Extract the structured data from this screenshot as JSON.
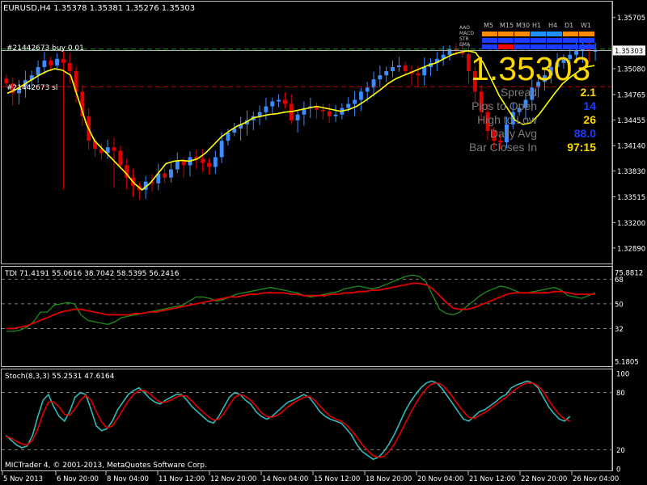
{
  "header": {
    "symbol_line": "EURUSD,H4  1.35378 1.35381 1.35276 1.35303",
    "tdi_line": "TDI 71.4191 55.0616 38.7042 58.5395 56.2416",
    "stoch_line": "Stoch(8,3,3) 55.2531 47.6164",
    "copyright": "MICTrader 4, © 2001-2013, MetaQuotes Software Corp."
  },
  "orders": {
    "buy_label": "#21442673 buy 0.01",
    "sl_label": "#21442673 sl"
  },
  "info_panel": {
    "price": "1.35303",
    "labels": [
      "Spread",
      "Pips to Open",
      "High to Low",
      "Daily Avg",
      "Bar Closes In"
    ],
    "values": [
      "2.1",
      "14",
      "26",
      "88.0",
      "97:15"
    ],
    "value_colors": [
      "#FFD700",
      "#1E3CFF",
      "#FFD700",
      "#1E3CFF",
      "#FFD700"
    ],
    "label_color": "#7a7a7a",
    "price_color": "#FFD700"
  },
  "mtf_panel": {
    "timeframes": [
      "M5",
      "M15",
      "M30",
      "H1",
      "H4",
      "D1",
      "W1"
    ],
    "rows": [
      {
        "name": "AAO",
        "colors": []
      },
      {
        "name": "MACD",
        "colors": [
          "#FF8C00",
          "#FF8C00",
          "#FF8C00",
          "#1E90FF",
          "#1E90FF",
          "#FF8C00",
          "#FF8C00"
        ]
      },
      {
        "name": "STR",
        "colors": [
          "#1E3CFF",
          "#1E3CFF",
          "#1E3CFF",
          "#1E3CFF",
          "#1E3CFF",
          "#1E3CFF",
          "#1E3CFF"
        ]
      },
      {
        "name": "EMA",
        "colors": [
          "#1E3CFF",
          "#FF0000",
          "#1E3CFF",
          "#1E3CFF",
          "#1E3CFF",
          "#1E3CFF",
          "#1E3CFF"
        ]
      }
    ]
  },
  "colors": {
    "bull": "#3C8CFF",
    "bear": "#E00000",
    "ma": "#FFFF00",
    "tdi_green": "#1E8C1E",
    "tdi_red": "#E00000",
    "stoch_cyan": "#35B8B8",
    "stoch_red": "#E00000",
    "grid": "#808080",
    "order_buy": "#20A020",
    "order_sl": "#C00000"
  },
  "chart_data": [
    {
      "type": "candlestick",
      "symbol": "EURUSD",
      "timeframe": "H4",
      "ylim": [
        1.327,
        1.359
      ],
      "y_ticks": [
        "1.35705",
        "1.35080",
        "1.34765",
        "1.34455",
        "1.34140",
        "1.33830",
        "1.33515",
        "1.33200",
        "1.32890"
      ],
      "y_tick_values": [
        1.35705,
        1.3508,
        1.34765,
        1.34455,
        1.3414,
        1.3383,
        1.33515,
        1.332,
        1.3289
      ],
      "current_price_tag": "1.35303",
      "current_price": 1.35303,
      "order_lines": [
        {
          "label": "#21442673 buy 0.01",
          "price": 1.3532
        },
        {
          "label": "#21442673 sl",
          "price": 1.3486
        }
      ],
      "x_labels": [
        "5 Nov 2013",
        "6 Nov 20:00",
        "8 Nov 04:00",
        "11 Nov 12:00",
        "12 Nov 20:00",
        "14 Nov 04:00",
        "15 Nov 12:00",
        "18 Nov 20:00",
        "20 Nov 04:00",
        "21 Nov 12:00",
        "22 Nov 20:00",
        "26 Nov 04:00"
      ],
      "closes": [
        1.349,
        1.3478,
        1.3485,
        1.3494,
        1.35,
        1.351,
        1.3518,
        1.3512,
        1.352,
        1.3515,
        1.3505,
        1.348,
        1.345,
        1.342,
        1.341,
        1.3405,
        1.3412,
        1.3408,
        1.339,
        1.3375,
        1.3365,
        1.336,
        1.337,
        1.3368,
        1.338,
        1.3375,
        1.3385,
        1.3395,
        1.339,
        1.34,
        1.3398,
        1.3393,
        1.3388,
        1.34,
        1.342,
        1.343,
        1.3435,
        1.344,
        1.3445,
        1.345,
        1.3455,
        1.3462,
        1.3468,
        1.347,
        1.3465,
        1.3445,
        1.3452,
        1.346,
        1.3462,
        1.3458,
        1.3456,
        1.345,
        1.3452,
        1.346,
        1.3465,
        1.347,
        1.348,
        1.3485,
        1.3495,
        1.35,
        1.3505,
        1.351,
        1.3512,
        1.3505,
        1.3502,
        1.35,
        1.351,
        1.3515,
        1.352,
        1.3525,
        1.3532,
        1.353,
        1.3526,
        1.3505,
        1.348,
        1.3455,
        1.3432,
        1.342,
        1.3418,
        1.344,
        1.3455,
        1.346,
        1.347,
        1.3485,
        1.3492,
        1.35,
        1.351,
        1.3515,
        1.352,
        1.3525,
        1.353,
        1.3535,
        1.353,
        1.35303
      ],
      "ma": [
        1.3478,
        1.3482,
        1.3488,
        1.3494,
        1.35,
        1.3505,
        1.3508,
        1.3506,
        1.35,
        1.347,
        1.344,
        1.342,
        1.341,
        1.34,
        1.339,
        1.338,
        1.3368,
        1.336,
        1.3368,
        1.338,
        1.3392,
        1.3395,
        1.3396,
        1.3395,
        1.3398,
        1.3405,
        1.3415,
        1.3425,
        1.3432,
        1.3438,
        1.3442,
        1.3448,
        1.345,
        1.3452,
        1.3453,
        1.3455,
        1.3456,
        1.3458,
        1.346,
        1.3462,
        1.346,
        1.3458,
        1.3456,
        1.3458,
        1.3462,
        1.3468,
        1.3475,
        1.3482,
        1.349,
        1.3496,
        1.35,
        1.3504,
        1.3508,
        1.3512,
        1.3515,
        1.352,
        1.3525,
        1.3528,
        1.353,
        1.3528,
        1.3515,
        1.3495,
        1.3475,
        1.346,
        1.3445,
        1.344,
        1.3442,
        1.3452,
        1.3465,
        1.3478,
        1.349,
        1.3498,
        1.3505,
        1.351,
        1.3512
      ]
    },
    {
      "type": "line",
      "name": "TDI",
      "y_ticks": [
        "75.8812",
        "68",
        "50",
        "32",
        "5.1805"
      ],
      "y_tick_values": [
        75.8812,
        68,
        50,
        32,
        5.1805
      ],
      "levels": [
        68,
        50,
        32
      ],
      "ylim": [
        5.1805,
        75.8812
      ],
      "series": [
        {
          "name": "green",
          "values": [
            30,
            30,
            31,
            33,
            37,
            44,
            44,
            49,
            50,
            51,
            50,
            42,
            38,
            37,
            36,
            35,
            37,
            40,
            41,
            42,
            43,
            44,
            45,
            46,
            47,
            48,
            49,
            52,
            55,
            55,
            54,
            52,
            53,
            55,
            57,
            58,
            59,
            60,
            61,
            62,
            61,
            60,
            59,
            58,
            56,
            55,
            56,
            57,
            58,
            59,
            61,
            62,
            63,
            62,
            61,
            62,
            64,
            66,
            68,
            70,
            71,
            70,
            66,
            56,
            46,
            43,
            42,
            44,
            48,
            52,
            56,
            59,
            61,
            63,
            62,
            60,
            58,
            58,
            59,
            60,
            61,
            62,
            60,
            56,
            55,
            54,
            56,
            58
          ]
        },
        {
          "name": "red",
          "values": [
            32,
            32,
            33,
            34,
            36,
            38,
            40,
            42,
            44,
            45,
            46,
            46,
            45,
            44,
            43,
            42,
            42,
            42,
            42,
            43,
            43,
            44,
            44,
            45,
            46,
            47,
            48,
            49,
            50,
            51,
            52,
            53,
            54,
            55,
            55,
            56,
            57,
            57,
            58,
            58,
            58,
            58,
            57,
            57,
            56,
            56,
            56,
            56,
            57,
            57,
            58,
            58,
            59,
            59,
            60,
            60,
            61,
            62,
            63,
            64,
            65,
            65,
            64,
            61,
            56,
            51,
            47,
            46,
            46,
            47,
            49,
            51,
            53,
            55,
            57,
            58,
            58,
            58,
            58,
            58,
            58,
            59,
            59,
            58,
            57,
            57,
            57,
            57
          ]
        }
      ]
    },
    {
      "type": "line",
      "name": "Stoch(8,3,3)",
      "y_ticks": [
        "100",
        "80",
        "20",
        "0"
      ],
      "y_tick_values": [
        100,
        80,
        20,
        0
      ],
      "levels": [
        80,
        20
      ],
      "ylim": [
        0,
        100
      ],
      "series": [
        {
          "name": "main",
          "values": [
            35,
            30,
            25,
            22,
            24,
            35,
            55,
            72,
            78,
            65,
            55,
            50,
            60,
            75,
            80,
            78,
            62,
            45,
            40,
            42,
            50,
            62,
            70,
            78,
            82,
            85,
            80,
            74,
            70,
            68,
            72,
            75,
            78,
            78,
            72,
            65,
            60,
            55,
            50,
            48,
            55,
            65,
            75,
            80,
            78,
            72,
            68,
            60,
            55,
            52,
            55,
            60,
            65,
            70,
            72,
            75,
            78,
            75,
            68,
            60,
            55,
            52,
            50,
            48,
            42,
            35,
            25,
            18,
            14,
            10,
            12,
            18,
            26,
            36,
            48,
            60,
            70,
            78,
            85,
            90,
            92,
            90,
            84,
            76,
            68,
            60,
            52,
            50,
            55,
            60,
            62,
            66,
            70,
            75,
            78,
            85,
            88,
            90,
            92,
            90,
            85,
            75,
            65,
            58,
            52,
            50,
            55
          ]
        },
        {
          "name": "signal",
          "values": [
            34,
            32,
            29,
            26,
            25,
            30,
            42,
            58,
            70,
            70,
            65,
            57,
            56,
            63,
            72,
            77,
            72,
            60,
            49,
            43,
            45,
            53,
            62,
            71,
            78,
            82,
            82,
            79,
            74,
            70,
            70,
            72,
            75,
            77,
            76,
            71,
            65,
            60,
            55,
            51,
            52,
            58,
            67,
            75,
            78,
            76,
            72,
            66,
            59,
            55,
            54,
            56,
            60,
            65,
            69,
            72,
            75,
            76,
            72,
            66,
            60,
            55,
            52,
            50,
            46,
            40,
            33,
            25,
            19,
            14,
            12,
            13,
            18,
            26,
            36,
            47,
            58,
            68,
            77,
            84,
            89,
            90,
            88,
            82,
            75,
            67,
            60,
            54,
            53,
            56,
            59,
            63,
            67,
            71,
            75,
            80,
            84,
            88,
            90,
            90,
            87,
            81,
            72,
            64,
            57,
            52,
            50
          ]
        }
      ]
    }
  ]
}
